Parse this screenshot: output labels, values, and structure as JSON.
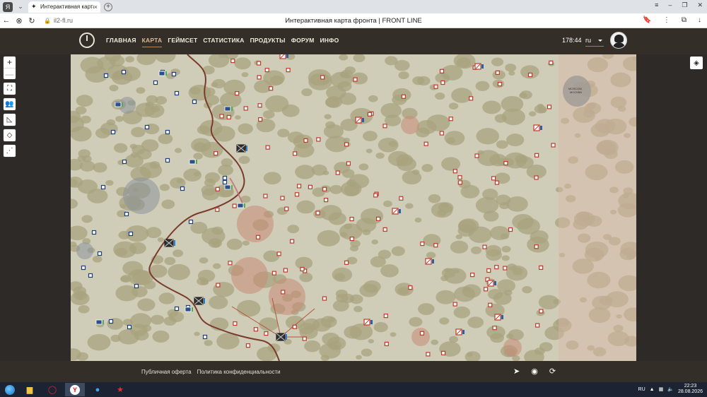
{
  "browser": {
    "tab_title": "Интерактивная карта",
    "url": "il2-fl.ru",
    "page_title": "Интерактивная карта фронта | FRONT LINE"
  },
  "header": {
    "nav": [
      {
        "label": "ГЛАВНАЯ",
        "active": false
      },
      {
        "label": "КАРТА",
        "active": true
      },
      {
        "label": "ГЕЙМСЕТ",
        "active": false
      },
      {
        "label": "СТАТИСТИКА",
        "active": false
      },
      {
        "label": "ПРОДУКТЫ",
        "active": false
      },
      {
        "label": "ФОРУМ",
        "active": false
      },
      {
        "label": "ИНФО",
        "active": false
      }
    ],
    "timer": "178:44",
    "language": "ru"
  },
  "map": {
    "tools": [
      "zoom-in",
      "zoom-out",
      "map-icon",
      "squad-icon",
      "ruler-icon",
      "eraser-icon",
      "share-icon"
    ],
    "zoom_in": "+",
    "zoom_out": "—",
    "city_label": "MOSCOW\nМОСКВА",
    "colors": {
      "forest": "#a8a37f",
      "field": "#cfccb7",
      "frontline": "#7a3b2c",
      "objective": "#c0392b",
      "blue_unit": "#1f3f7a"
    }
  },
  "footer": {
    "links": [
      "Публичная оферта",
      "Политика конфиденциальности"
    ],
    "icons": [
      "telegram-icon",
      "discord-icon",
      "support-icon"
    ]
  },
  "taskbar": {
    "lang": "RU",
    "time": "22:23",
    "date": "28.08.2026"
  }
}
